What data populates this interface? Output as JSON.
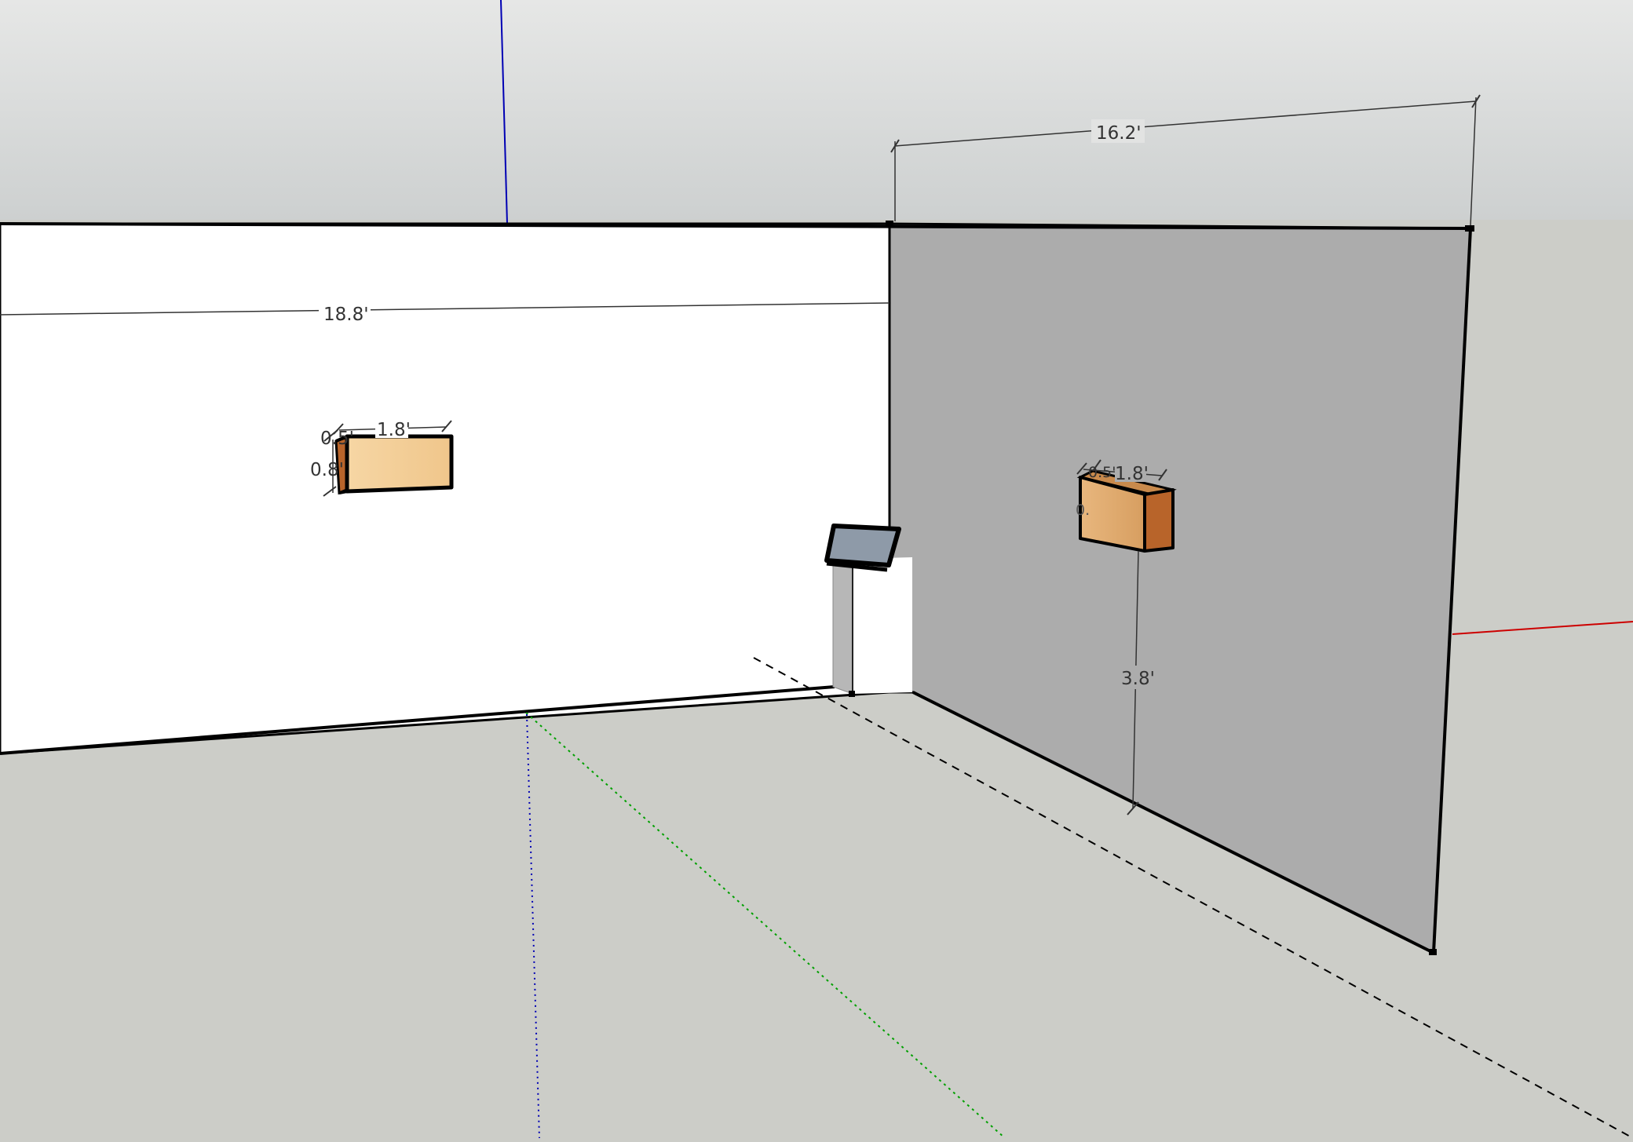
{
  "scene": {
    "dimensions": {
      "front_wall_width": "18.8'",
      "side_wall_width": "16.2'",
      "speaker_height_from_floor": "3.8'",
      "left_speaker_length": "1.8'",
      "left_speaker_height": "0.8'",
      "left_speaker_depth": "0.5'",
      "right_speaker_length": "1.8'",
      "right_speaker_depth": "0.5'",
      "right_speaker_height": "0."
    },
    "colors": {
      "sky_top": "#e6e7e6",
      "sky_bottom": "#cdd0d0",
      "ground": "#cccdc8",
      "front_wall": "#ffffff",
      "side_wall": "#acacac",
      "speaker_face": "#f4cf96",
      "speaker_side": "#b8642a",
      "x_axis": "#cc0000",
      "y_axis": "#00a000",
      "z_axis": "#0000b4"
    },
    "icons": [
      "speaker-box-left",
      "speaker-box-right",
      "lectern"
    ]
  }
}
